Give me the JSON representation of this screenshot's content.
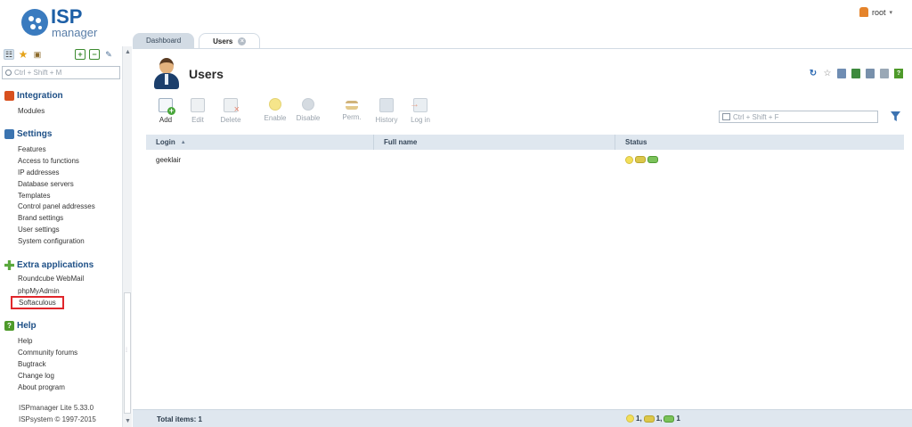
{
  "app": {
    "logo_text": "ISP",
    "logo_sub": "manager"
  },
  "user": {
    "name": "root"
  },
  "sidebar": {
    "search_placeholder": "Ctrl + Shift + M",
    "sections": [
      {
        "title": "Integration",
        "items": [
          "Modules"
        ]
      },
      {
        "title": "Settings",
        "items": [
          "Features",
          "Access to functions",
          "IP addresses",
          "Database servers",
          "Templates",
          "Control panel addresses",
          "Brand settings",
          "User settings",
          "System configuration"
        ]
      },
      {
        "title": "Extra applications",
        "items": [
          "Roundcube WebMail",
          "phpMyAdmin",
          "Softaculous"
        ]
      },
      {
        "title": "Help",
        "items": [
          "Help",
          "Community forums",
          "Bugtrack",
          "Change log",
          "About program"
        ]
      }
    ],
    "version": "ISPmanager Lite 5.33.0",
    "copyright": "ISPsystem © 1997-2015"
  },
  "tabs": [
    {
      "label": "Dashboard"
    },
    {
      "label": "Users",
      "active": true
    }
  ],
  "page": {
    "title": "Users"
  },
  "toolbar": {
    "buttons": [
      {
        "label": "Add",
        "icon": "add-user-icon",
        "enabled": true
      },
      {
        "label": "Edit",
        "icon": "edit-icon",
        "enabled": false
      },
      {
        "label": "Delete",
        "icon": "delete-icon",
        "enabled": false
      },
      {
        "label": "Enable",
        "icon": "bulb-on-icon",
        "enabled": false
      },
      {
        "label": "Disable",
        "icon": "bulb-off-icon",
        "enabled": false
      },
      {
        "label": "Perm.",
        "icon": "key-icon",
        "enabled": false
      },
      {
        "label": "History",
        "icon": "history-icon",
        "enabled": false
      },
      {
        "label": "Log in",
        "icon": "login-icon",
        "enabled": false
      }
    ],
    "filter_placeholder": "Ctrl + Shift + F"
  },
  "table": {
    "columns": [
      "Login",
      "Full name",
      "Status"
    ],
    "rows": [
      {
        "login": "geeklair",
        "full_name": ""
      }
    ],
    "footer": {
      "total_label": "Total items: 1",
      "count_enabled": "1,",
      "count_ftp": "1,",
      "count_mail": "1"
    }
  },
  "colors": {
    "accent": "#1d4f86",
    "highlight_box": "#e0262b",
    "header_bg": "#dfe7ef"
  }
}
